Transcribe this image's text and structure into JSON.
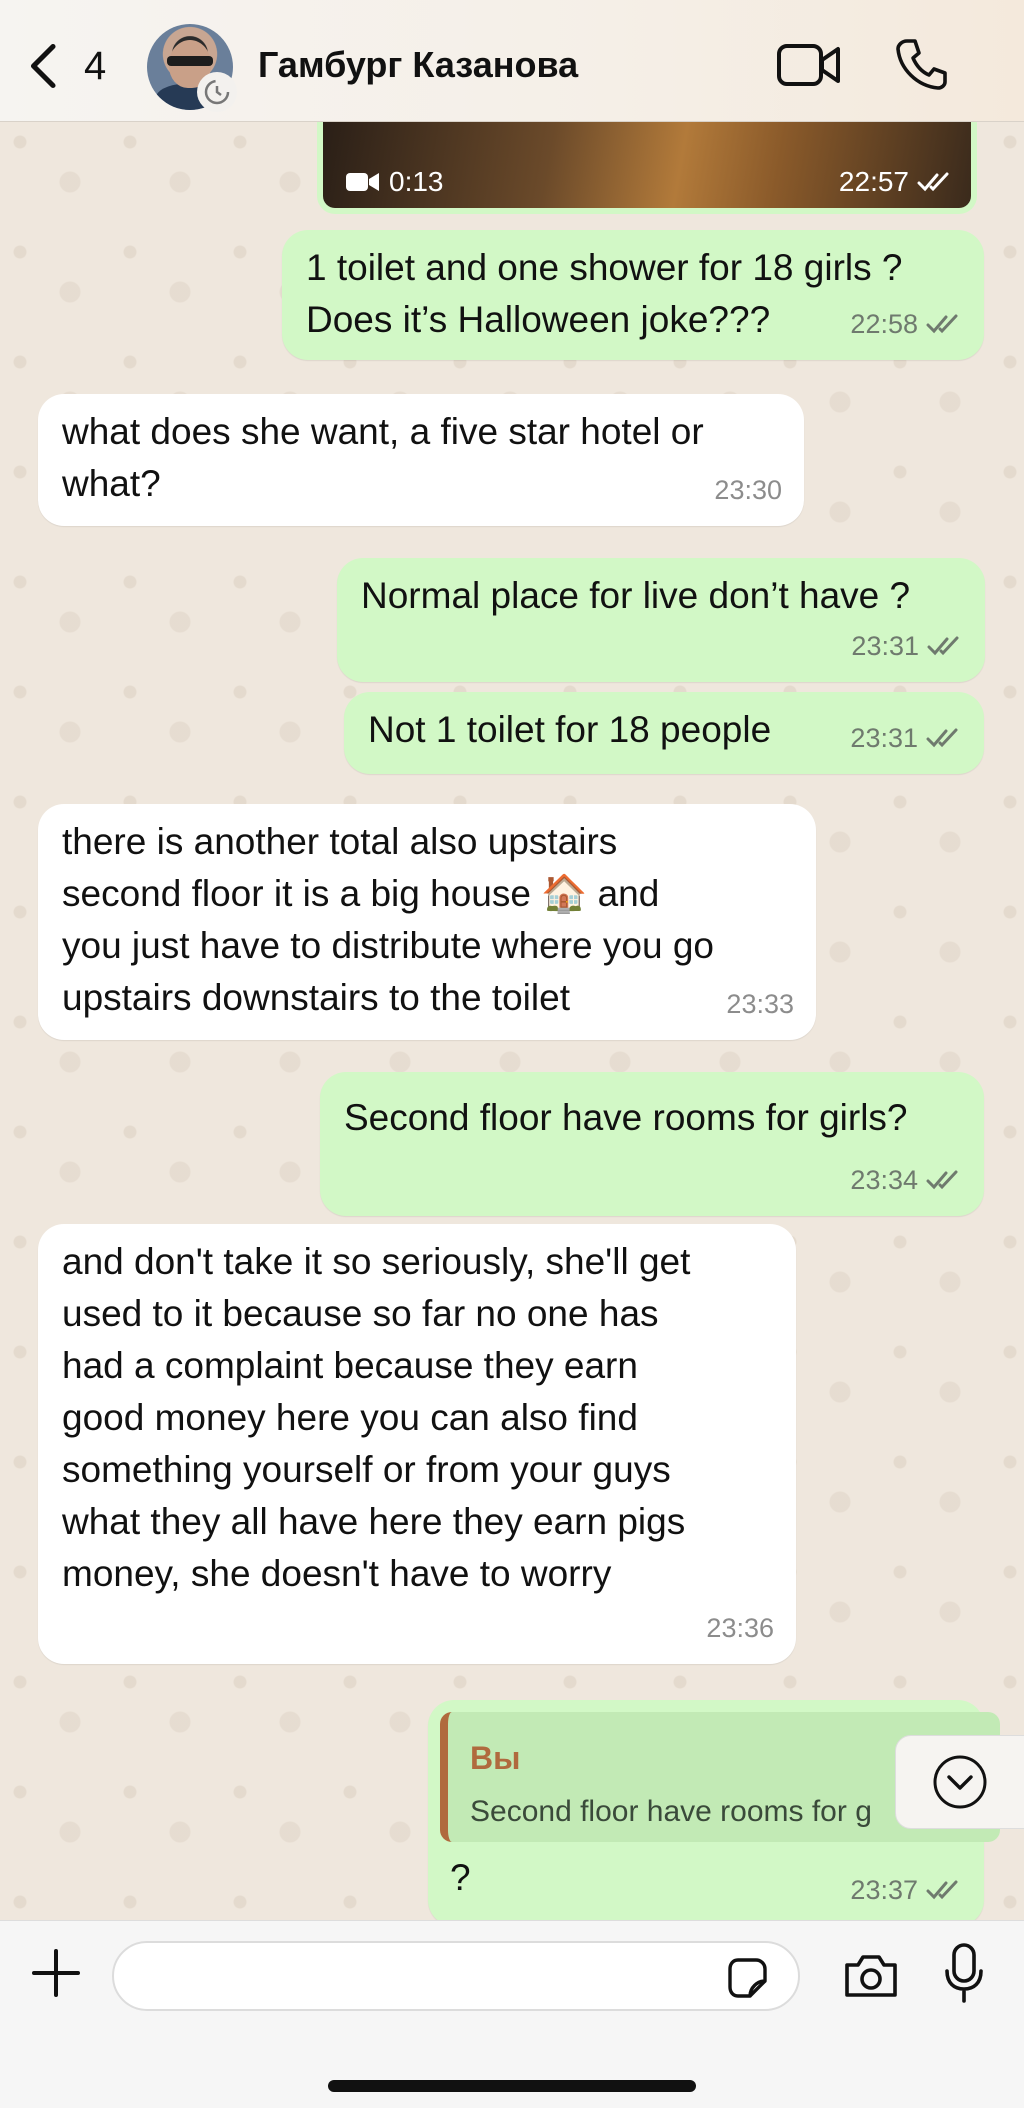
{
  "header": {
    "back_count": "4",
    "contact_name": "Гамбург Казанова"
  },
  "video_message": {
    "duration": "0:13",
    "time": "22:57"
  },
  "messages": [
    {
      "dir": "out",
      "text": "1 toilet and one shower for 18 girls ?\nDoes it’s Halloween joke???",
      "time": "22:58"
    },
    {
      "dir": "in",
      "text": "what does she want, a five star hotel or\nwhat?",
      "time": "23:30"
    },
    {
      "dir": "out",
      "text": "Normal place for live don’t have ?",
      "time": "23:31"
    },
    {
      "dir": "out",
      "text": "Not 1 toilet for 18 people",
      "time": "23:31"
    },
    {
      "dir": "in",
      "text": "there is another total also upstairs\nsecond floor it is a big house 🏠 and\nyou just have to distribute where you go\nupstairs downstairs to the toilet",
      "time": "23:33"
    },
    {
      "dir": "out",
      "text": "Second floor have rooms for girls?",
      "time": "23:34"
    },
    {
      "dir": "in",
      "text": "and don't take it so seriously, she'll get\nused to it because so far no one has\nhad a complaint because they earn\ngood money here you can also find\nsomething yourself or from your guys\nwhat they all have here they earn pigs\nmoney, she doesn't have to worry",
      "time": "23:36"
    }
  ],
  "reply_message": {
    "quote_author": "Вы",
    "quote_text": "Second floor have rooms for g",
    "text": "?",
    "time": "23:37"
  },
  "icons": {
    "back": "chevron-left-icon",
    "video": "video-camera-icon",
    "phone": "phone-icon",
    "plus": "plus-icon",
    "sticker": "sticker-icon",
    "camera": "camera-icon",
    "mic": "microphone-icon",
    "scroll": "chevron-down-circle-icon"
  },
  "colors": {
    "outgoing_bubble": "#d2f8c6",
    "incoming_bubble": "#ffffff",
    "chat_background": "#efe7dd",
    "reply_accent": "#b06a3e"
  }
}
